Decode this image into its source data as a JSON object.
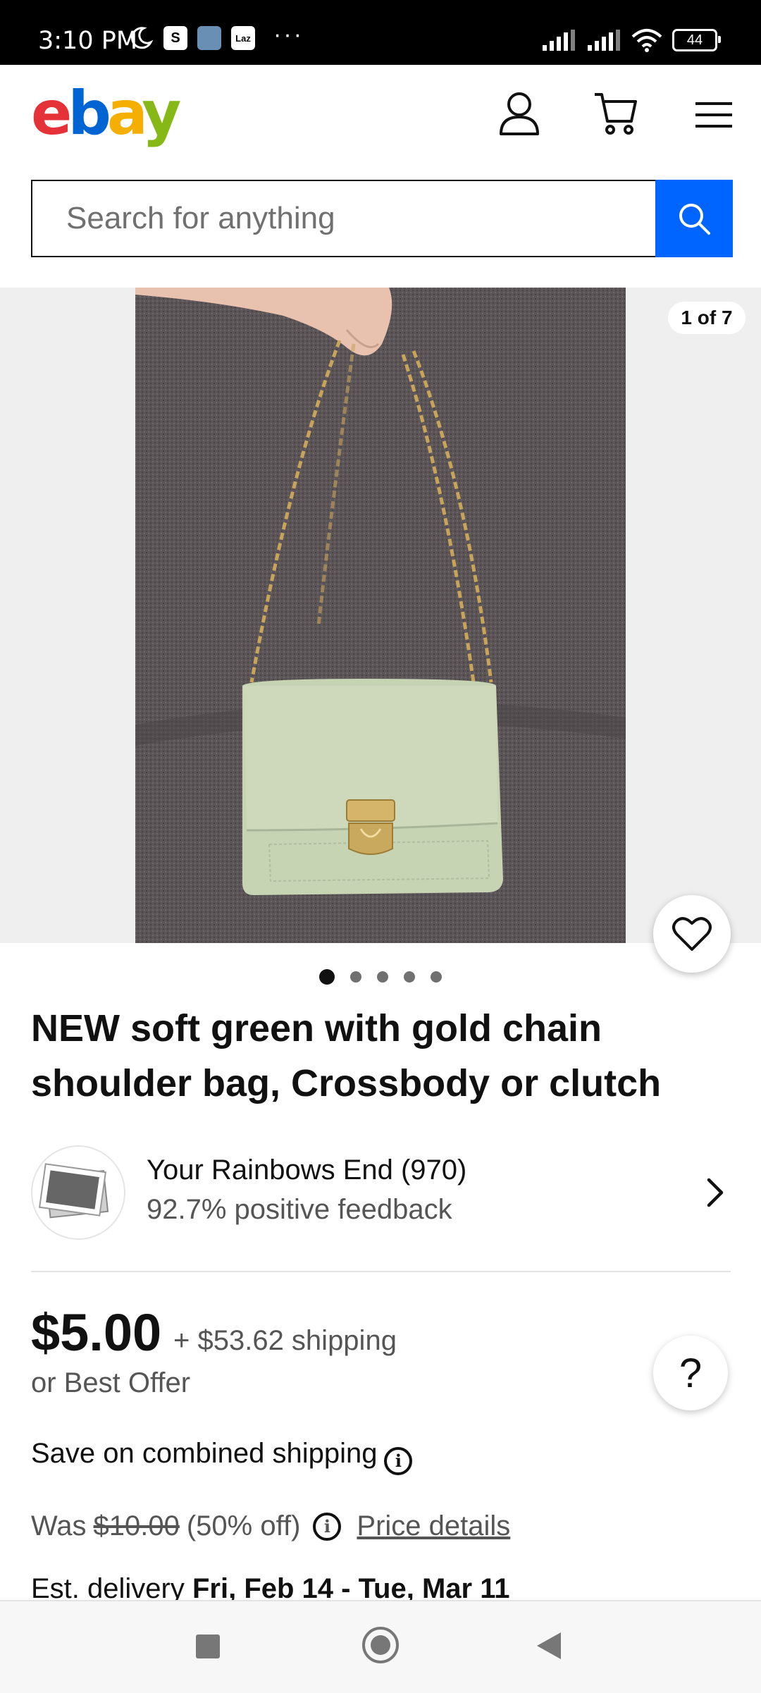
{
  "status_bar": {
    "time": "3:10 PM",
    "app_icons": [
      "S",
      "Laz"
    ],
    "battery": "44",
    "more": "···"
  },
  "header": {
    "logo_letters": [
      {
        "char": "e",
        "color": "#e53238"
      },
      {
        "char": "b",
        "color": "#0064d2"
      },
      {
        "char": "a",
        "color": "#f5af02"
      },
      {
        "char": "y",
        "color": "#86b817"
      }
    ],
    "icons": [
      "account-icon",
      "cart-icon",
      "menu-icon"
    ]
  },
  "search": {
    "placeholder": "Search for anything",
    "button_color": "#0064ff"
  },
  "gallery": {
    "counter": "1 of 7",
    "dots_total": 5,
    "active_dot": 0
  },
  "listing": {
    "title": "NEW soft green with gold chain shoulder bag, Crossbody or clutch"
  },
  "seller": {
    "name": "Your Rainbows End (970)",
    "feedback": "92.7% positive feedback"
  },
  "pricing": {
    "price": "$5.00",
    "shipping": "+ $53.62 shipping",
    "best_offer": "or Best Offer",
    "combined_shipping": "Save on combined shipping",
    "was_label": "Was",
    "was_price": "$10.00",
    "discount": "(50% off)",
    "price_details_link": "Price details",
    "est_delivery_label": "Est. delivery",
    "est_delivery_dates": "Fri, Feb 14 - Tue, Mar 11"
  },
  "help": {
    "label": "?"
  }
}
